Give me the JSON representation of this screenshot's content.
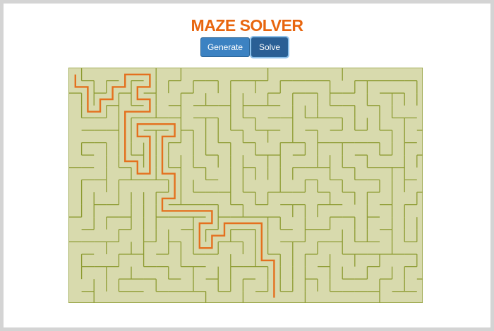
{
  "app": {
    "title": "MAZE SOLVER"
  },
  "toolbar": {
    "generate_label": "Generate",
    "solve_label": "Solve"
  },
  "maze": {
    "columns": 29,
    "rows": 19,
    "background_color": "#d8daad",
    "wall_color": "#8c9a30",
    "path_color": "#e4701e",
    "solution_shown": true
  }
}
